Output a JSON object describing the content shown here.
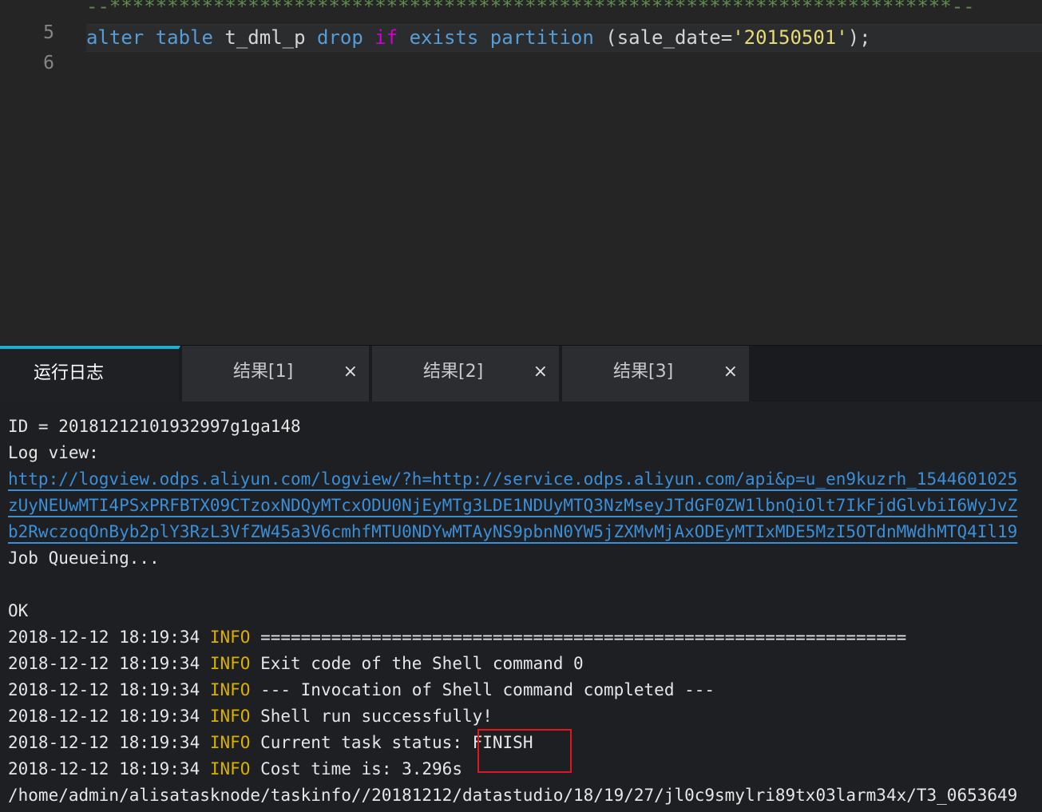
{
  "editor": {
    "lines": [
      {
        "number": "5",
        "comment": "--*************************************************************************--"
      },
      {
        "number": "6",
        "tokens": {
          "t1": "alter",
          "t2": " ",
          "t3": "table",
          "t4": " t_dml_p ",
          "t5": "drop",
          "t6": " ",
          "t7": "if",
          "t8": " ",
          "t9": "exists",
          "t10": " ",
          "t11": "partition",
          "t12": " (sale_date=",
          "t13": "'20150501'",
          "t14": ");"
        }
      }
    ]
  },
  "tabs": [
    {
      "label": "运行日志",
      "closable": false
    },
    {
      "label": "结果[1]",
      "close": "×"
    },
    {
      "label": "结果[2]",
      "close": "×"
    },
    {
      "label": "结果[3]",
      "close": "×"
    }
  ],
  "log": {
    "id_line": "ID = 20181212101932997g1ga148",
    "logview_label": "Log view:",
    "link_lines": [
      "http://logview.odps.aliyun.com/logview/?h=http://service.odps.aliyun.com/api&p=u_en9kuzrh_1544601025",
      "zUyNEUwMTI4PSxPRFBTX09CTzoxNDQyMTcxODU0NjEyMTg3LDE1NDUyMTQ3NzMseyJTdGF0ZW1lbnQiOlt7IkFjdGlvbiI6WyJvZ",
      "b2RwczoqOnByb2plY3RzL3VfZW45a3V6cmhfMTU0NDYwMTAyNS9pbnN0YW5jZXMvMjAxODEyMTIxMDE5MzI5OTdnMWdhMTQ4Il19"
    ],
    "queue": "Job Queueing...",
    "ok": "OK",
    "entries": [
      {
        "ts": "2018-12-12 18:19:34 ",
        "level": "INFO",
        "msg": " ================================================================"
      },
      {
        "ts": "2018-12-12 18:19:34 ",
        "level": "INFO",
        "msg": " Exit code of the Shell command 0"
      },
      {
        "ts": "2018-12-12 18:19:34 ",
        "level": "INFO",
        "msg": " --- Invocation of Shell command completed ---"
      },
      {
        "ts": "2018-12-12 18:19:34 ",
        "level": "INFO",
        "msg": " Shell run successfully!"
      },
      {
        "ts": "2018-12-12 18:19:34 ",
        "level": "INFO",
        "msg": " Current task status: FINISH"
      },
      {
        "ts": "2018-12-12 18:19:34 ",
        "level": "INFO",
        "msg": " Cost time is: 3.296s"
      }
    ],
    "path": "/home/admin/alisatasknode/taskinfo//20181212/datastudio/18/19/27/jl0c9smylri89tx03larm34x/T3_0653649"
  },
  "colors": {
    "accent": "#14b3d6",
    "info": "#d8b100",
    "link": "#3a8fd9",
    "highlight": "#e0171d"
  }
}
